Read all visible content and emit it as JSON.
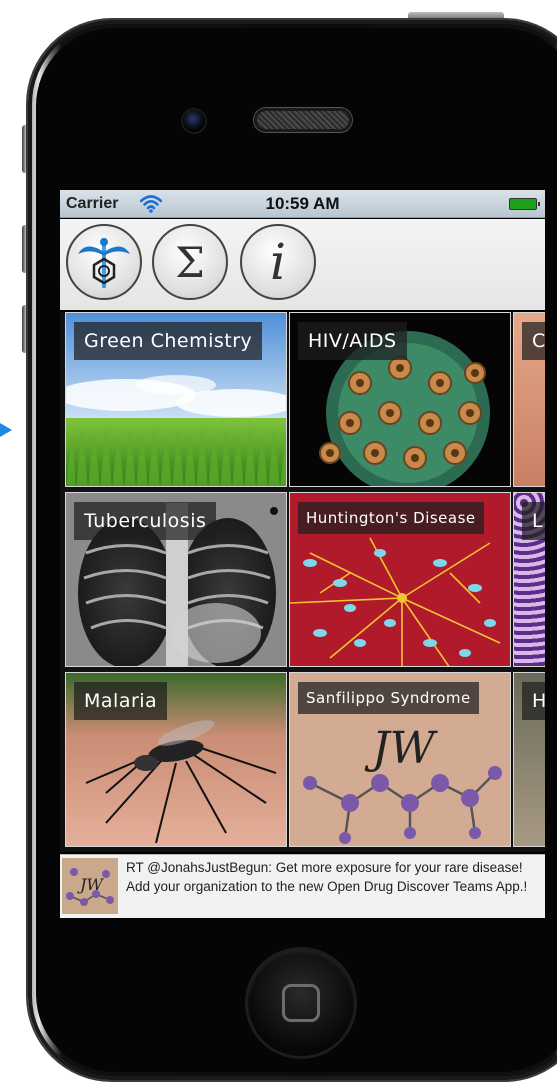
{
  "status_bar": {
    "carrier": "Carrier",
    "time": "10:59 AM",
    "wifi_icon": "wifi-icon",
    "battery_icon": "battery-icon",
    "battery_color": "#1aa31a"
  },
  "toolbar": {
    "buttons": [
      {
        "icon": "caduceus-benzene-icon"
      },
      {
        "icon": "sigma-icon"
      },
      {
        "icon": "info-icon"
      }
    ]
  },
  "tiles": [
    {
      "label": "Green Chemistry"
    },
    {
      "label": "HIV/AIDS"
    },
    {
      "label": "C"
    },
    {
      "label": "Tuberculosis"
    },
    {
      "label": "Huntington's Disease"
    },
    {
      "label": "L"
    },
    {
      "label": "Malaria"
    },
    {
      "label": "Sanfilippo Syndrome"
    },
    {
      "label": "H"
    }
  ],
  "feed": {
    "text": "RT @JonahsJustBegun: Get more exposure for your rare disease!  Add your organization to the new Open Drug Discover Teams App.!"
  }
}
